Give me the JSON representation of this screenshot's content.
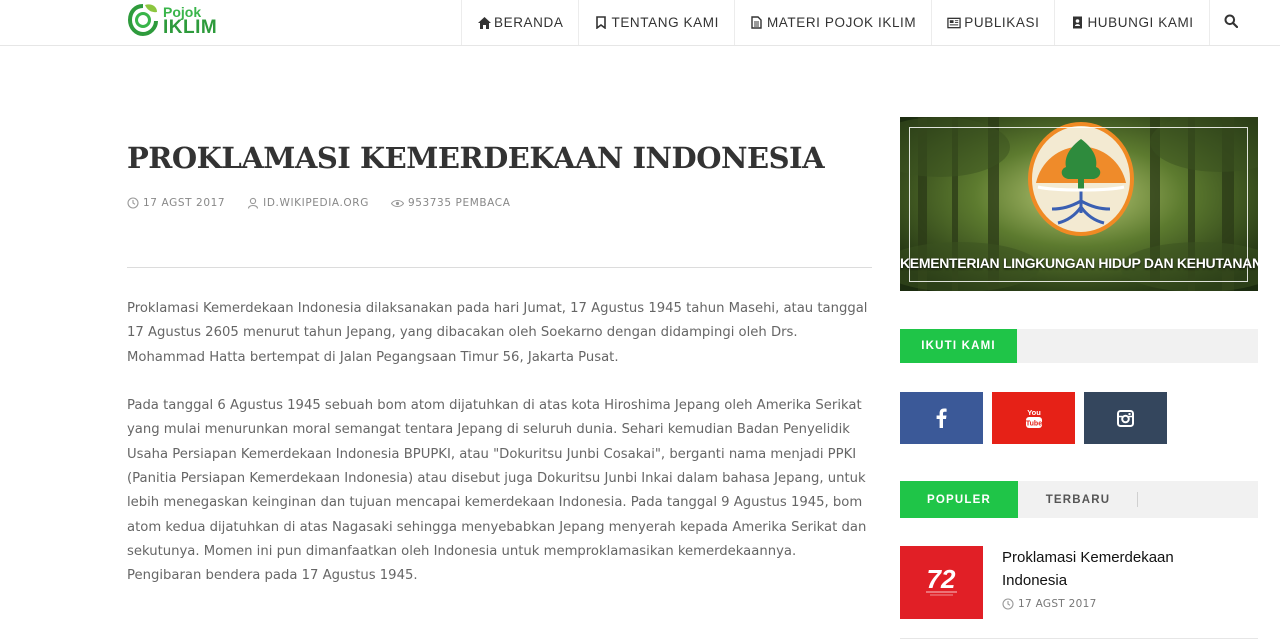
{
  "logo": {
    "line1": "Pojok",
    "line2": "IKLIM"
  },
  "nav": {
    "items": [
      {
        "label": "BERANDA",
        "icon": "home-icon"
      },
      {
        "label": "TENTANG KAMI",
        "icon": "bookmark-icon"
      },
      {
        "label": "MATERI POJOK IKLIM",
        "icon": "file-text-icon"
      },
      {
        "label": "PUBLIKASI",
        "icon": "newspaper-icon"
      },
      {
        "label": "HUBUNGI KAMI",
        "icon": "address-book-icon"
      }
    ],
    "search_icon": "search-icon"
  },
  "article": {
    "title": "PROKLAMASI KEMERDEKAAN INDONESIA",
    "date": "17 AGST 2017",
    "source": "ID.WIKIPEDIA.ORG",
    "views": "953735 PEMBACA",
    "paragraphs": [
      "Proklamasi Kemerdekaan Indonesia dilaksanakan pada hari Jumat, 17 Agustus 1945 tahun Masehi, atau tanggal 17 Agustus 2605 menurut tahun Jepang, yang dibacakan oleh Soekarno dengan didampingi oleh Drs. Mohammad Hatta bertempat di Jalan Pegangsaan Timur 56, Jakarta Pusat.",
      "Pada tanggal 6 Agustus 1945 sebuah bom atom dijatuhkan di atas kota Hiroshima Jepang oleh Amerika Serikat yang mulai menurunkan moral semangat tentara Jepang di seluruh dunia. Sehari kemudian Badan Penyelidik Usaha Persiapan Kemerdekaan Indonesia BPUPKI, atau \"Dokuritsu Junbi Cosakai\", berganti nama menjadi PPKI (Panitia Persiapan Kemerdekaan Indonesia) atau disebut juga Dokuritsu Junbi Inkai dalam bahasa Jepang, untuk lebih menegaskan keinginan dan tujuan mencapai kemerdekaan Indonesia. Pada tanggal 9 Agustus 1945, bom atom kedua dijatuhkan di atas Nagasaki sehingga menyebabkan Jepang menyerah kepada Amerika Serikat dan sekutunya. Momen ini pun dimanfaatkan oleh Indonesia untuk memproklamasikan kemerdekaannya.",
      "Pengibaran bendera pada 17 Agustus 1945."
    ]
  },
  "sidebar": {
    "ad_caption": "KEMENTERIAN LINGKUNGAN HIDUP DAN KEHUTANAN",
    "follow_label": "IKUTI KAMI",
    "social": [
      {
        "name": "facebook",
        "icon": "facebook-icon",
        "color": "#3b5998"
      },
      {
        "name": "youtube",
        "icon": "youtube-icon",
        "color": "#e62117"
      },
      {
        "name": "instagram",
        "icon": "instagram-icon",
        "color": "#34465d"
      }
    ],
    "tabs": {
      "popular": "POPULER",
      "latest": "TERBARU"
    },
    "post": {
      "title": "Proklamasi Kemerdekaan Indonesia",
      "date": "17 AGST 2017",
      "thumb_text": "72"
    }
  },
  "colors": {
    "accent_green": "#1fc548",
    "logo_green": "#2e9b3c"
  }
}
